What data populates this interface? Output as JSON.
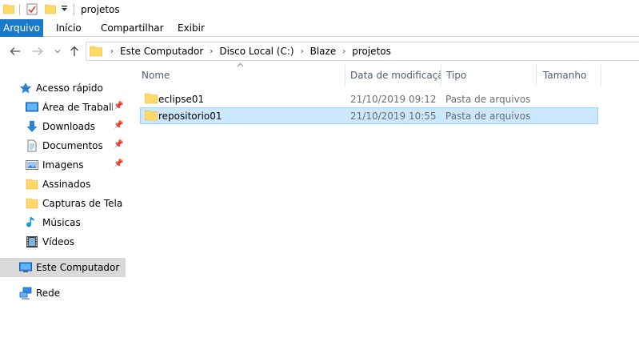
{
  "window": {
    "title": "projetos"
  },
  "ribbon": {
    "tabs": [
      {
        "label": "Arquivo",
        "active": true
      },
      {
        "label": "Início"
      },
      {
        "label": "Compartilhar"
      },
      {
        "label": "Exibir"
      }
    ]
  },
  "address": {
    "crumbs": [
      "Este Computador",
      "Disco Local (C:)",
      "Blaze",
      "projetos"
    ]
  },
  "sidebar": {
    "quick_access": "Acesso rápido",
    "items": [
      {
        "label": "Área de Trabalho",
        "icon": "desktop-icon",
        "pinned": true
      },
      {
        "label": "Downloads",
        "icon": "download-arrow-icon",
        "pinned": true
      },
      {
        "label": "Documentos",
        "icon": "document-icon",
        "pinned": true
      },
      {
        "label": "Imagens",
        "icon": "pictures-icon",
        "pinned": true
      },
      {
        "label": "Assinados",
        "icon": "folder-icon",
        "pinned": false
      },
      {
        "label": "Capturas de Tela",
        "icon": "folder-icon",
        "pinned": false
      },
      {
        "label": "Músicas",
        "icon": "music-note-icon",
        "pinned": false
      },
      {
        "label": "Vídeos",
        "icon": "video-icon",
        "pinned": false
      }
    ],
    "this_pc": "Este Computador",
    "network": "Rede"
  },
  "columns": {
    "name": "Nome",
    "date": "Data de modificaçã...",
    "type": "Tipo",
    "size": "Tamanho"
  },
  "files": [
    {
      "name": "eclipse01",
      "date": "21/10/2019 09:12",
      "type": "Pasta de arquivos",
      "size": "",
      "selected": false
    },
    {
      "name": "repositorio01",
      "date": "21/10/2019 10:55",
      "type": "Pasta de arquivos",
      "size": "",
      "selected": true
    }
  ],
  "colors": {
    "accent": "#1979ca",
    "selection_bg": "#cce8ff",
    "selection_border": "#99d1ff",
    "folder": "#ffd866"
  }
}
